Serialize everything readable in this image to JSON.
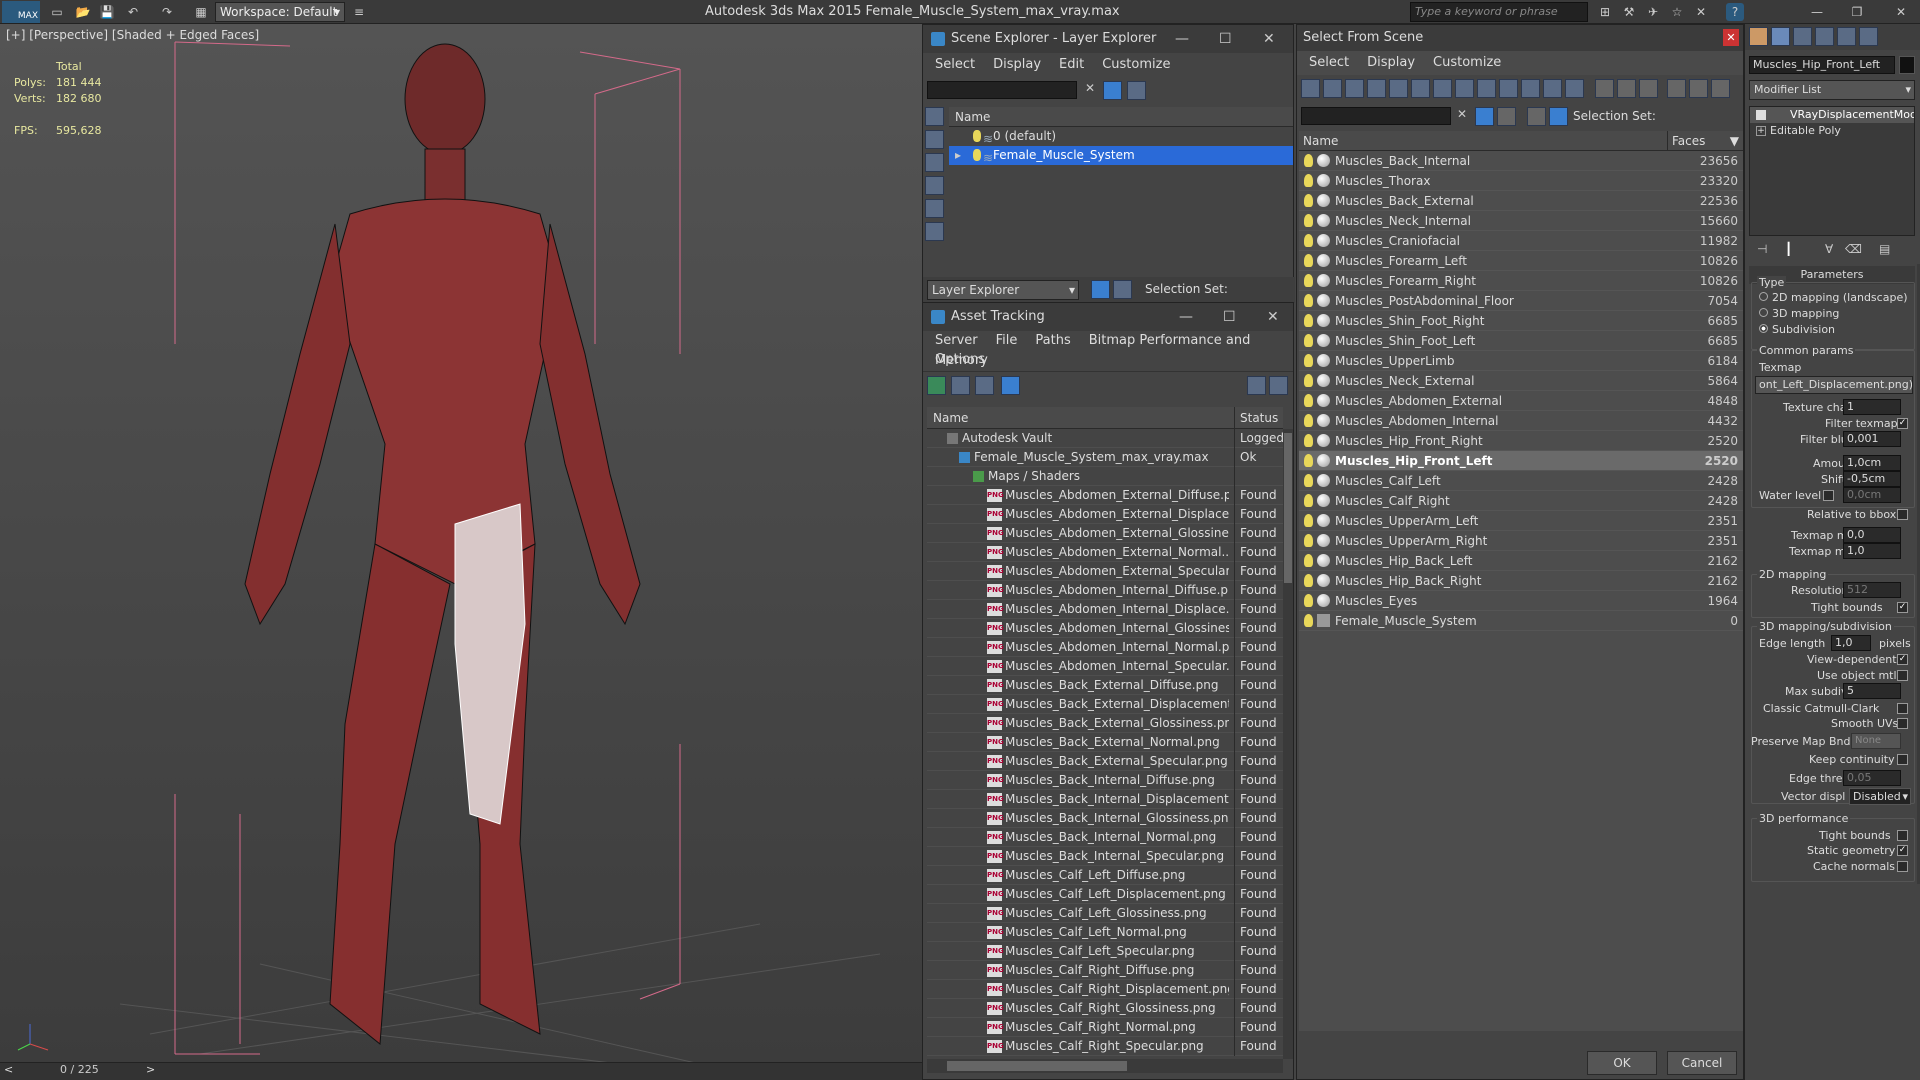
{
  "app": {
    "title": "Autodesk 3ds Max  2015     Female_Muscle_System_max_vray.max",
    "workspace": "Workspace: Default",
    "search_placeholder": "Type a keyword or phrase",
    "logo": "MAX"
  },
  "viewport": {
    "label": "[+] [Perspective] [Shaded + Edged Faces]",
    "stats": {
      "total_label": "Total",
      "polys_label": "Polys:",
      "polys": "181 444",
      "verts_label": "Verts:",
      "verts": "182 680",
      "fps_label": "FPS:",
      "fps": "595,628"
    },
    "timeline": "0 / 225"
  },
  "layer_explorer": {
    "title": "Scene Explorer - Layer Explorer",
    "menu": [
      "Select",
      "Display",
      "Edit",
      "Customize"
    ],
    "col_name": "Name",
    "rows": [
      "0 (default)",
      "Female_Muscle_System"
    ],
    "footer_dropdown": "Layer Explorer",
    "selection_set": "Selection Set:"
  },
  "asset_tracking": {
    "title": "Asset Tracking",
    "menu": [
      "Server",
      "File",
      "Paths",
      "Bitmap Performance and Memory"
    ],
    "menu2": "Options",
    "col_name": "Name",
    "col_status": "Status",
    "tree": [
      {
        "name": "Autodesk Vault",
        "status": "Logged"
      },
      {
        "name": "Female_Muscle_System_max_vray.max",
        "status": "Ok"
      },
      {
        "name": "Maps / Shaders",
        "status": ""
      }
    ],
    "files": [
      "Muscles_Abdomen_External_Diffuse.p...",
      "Muscles_Abdomen_External_Displace...",
      "Muscles_Abdomen_External_Glossines...",
      "Muscles_Abdomen_External_Normal....",
      "Muscles_Abdomen_External_Specular....",
      "Muscles_Abdomen_Internal_Diffuse.p...",
      "Muscles_Abdomen_Internal_Displace...",
      "Muscles_Abdomen_Internal_Glossines...",
      "Muscles_Abdomen_Internal_Normal.p...",
      "Muscles_Abdomen_Internal_Specular....",
      "Muscles_Back_External_Diffuse.png",
      "Muscles_Back_External_Displacement....",
      "Muscles_Back_External_Glossiness.png",
      "Muscles_Back_External_Normal.png",
      "Muscles_Back_External_Specular.png",
      "Muscles_Back_Internal_Diffuse.png",
      "Muscles_Back_Internal_Displacement....",
      "Muscles_Back_Internal_Glossiness.png",
      "Muscles_Back_Internal_Normal.png",
      "Muscles_Back_Internal_Specular.png",
      "Muscles_Calf_Left_Diffuse.png",
      "Muscles_Calf_Left_Displacement.png",
      "Muscles_Calf_Left_Glossiness.png",
      "Muscles_Calf_Left_Normal.png",
      "Muscles_Calf_Left_Specular.png",
      "Muscles_Calf_Right_Diffuse.png",
      "Muscles_Calf_Right_Displacement.png",
      "Muscles_Calf_Right_Glossiness.png",
      "Muscles_Calf_Right_Normal.png",
      "Muscles_Calf_Right_Specular.png"
    ],
    "found": "Found"
  },
  "select_from_scene": {
    "title": "Select From Scene",
    "menu": [
      "Select",
      "Display",
      "Customize"
    ],
    "selection_set": "Selection Set:",
    "col_name": "Name",
    "col_faces": "Faces",
    "rows": [
      [
        "Muscles_Back_Internal",
        "23656"
      ],
      [
        "Muscles_Thorax",
        "23320"
      ],
      [
        "Muscles_Back_External",
        "22536"
      ],
      [
        "Muscles_Neck_Internal",
        "15660"
      ],
      [
        "Muscles_Craniofacial",
        "11982"
      ],
      [
        "Muscles_Forearm_Left",
        "10826"
      ],
      [
        "Muscles_Forearm_Right",
        "10826"
      ],
      [
        "Muscles_PostAbdominal_Floor",
        "7054"
      ],
      [
        "Muscles_Shin_Foot_Right",
        "6685"
      ],
      [
        "Muscles_Shin_Foot_Left",
        "6685"
      ],
      [
        "Muscles_UpperLimb",
        "6184"
      ],
      [
        "Muscles_Neck_External",
        "5864"
      ],
      [
        "Muscles_Abdomen_External",
        "4848"
      ],
      [
        "Muscles_Abdomen_Internal",
        "4432"
      ],
      [
        "Muscles_Hip_Front_Right",
        "2520"
      ],
      [
        "Muscles_Hip_Front_Left",
        "2520"
      ],
      [
        "Muscles_Calf_Left",
        "2428"
      ],
      [
        "Muscles_Calf_Right",
        "2428"
      ],
      [
        "Muscles_UpperArm_Left",
        "2351"
      ],
      [
        "Muscles_UpperArm_Right",
        "2351"
      ],
      [
        "Muscles_Hip_Back_Left",
        "2162"
      ],
      [
        "Muscles_Hip_Back_Right",
        "2162"
      ],
      [
        "Muscles_Eyes",
        "1964"
      ],
      [
        "Female_Muscle_System",
        "0"
      ]
    ],
    "selected_index": 15,
    "ok": "OK",
    "cancel": "Cancel"
  },
  "command_panel": {
    "object_name": "Muscles_Hip_Front_Left",
    "modifier_list": "Modifier List",
    "stack": [
      "VRayDisplacementMod",
      "Editable Poly"
    ],
    "parameters": "Parameters",
    "type_label": "Type",
    "types": [
      "2D mapping (landscape)",
      "3D mapping",
      "Subdivision"
    ],
    "common": "Common params",
    "texmap": "Texmap",
    "texmap_value": "ont_Left_Displacement.png)",
    "texture_chan_label": "Texture chan",
    "texture_chan": "1",
    "filter_texmap": "Filter texmap",
    "filter_blur_label": "Filter blur",
    "filter_blur": "0,001",
    "amount_label": "Amount",
    "amount": "1,0cm",
    "shift_label": "Shift",
    "shift": "-0,5cm",
    "water_label": "Water level",
    "water": "0,0cm",
    "relative": "Relative to bbox",
    "texmap_min_label": "Texmap min",
    "texmap_min": "0,0",
    "texmap_max_label": "Texmap max",
    "texmap_max": "1,0",
    "g2d": "2D mapping",
    "resolution_label": "Resolution",
    "resolution": "512",
    "tight_bounds": "Tight bounds",
    "g3d": "3D mapping/subdivision",
    "edge_length_label": "Edge length",
    "edge_length": "1,0",
    "pixels": "pixels",
    "view_dep": "View-dependent",
    "use_obj_mtl": "Use object mtl",
    "max_subdivs_label": "Max subdivs",
    "max_subdivs": "5",
    "catmull": "Classic Catmull-Clark",
    "smooth_uvs": "Smooth UVs",
    "preserve": "Preserve Map Bnd",
    "preserve_val": "None",
    "keep_cont": "Keep continuity",
    "edge_thresh_label": "Edge thresh",
    "edge_thresh": "0,05",
    "vector_label": "Vector displ",
    "vector": "Disabled",
    "gperf": "3D performance",
    "tight_bounds2": "Tight bounds",
    "static_geo": "Static geometry",
    "cache_normals": "Cache normals"
  }
}
